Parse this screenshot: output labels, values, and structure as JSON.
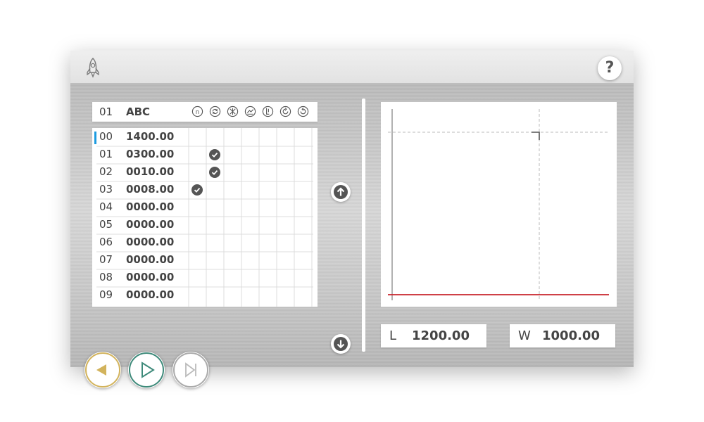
{
  "header": {
    "logo_icon": "rocket-icon",
    "help_label": "?"
  },
  "program": {
    "number": "01",
    "name": "ABC",
    "mode_icons": [
      "n-icon",
      "rotate-icon",
      "cross-icon",
      "bend-icon",
      "clamp-icon",
      "clockwise-icon",
      "counterclockwise-icon"
    ]
  },
  "steps": [
    {
      "id": "00",
      "value": "1400.00",
      "checked_col": null,
      "selected": true
    },
    {
      "id": "01",
      "value": "0300.00",
      "checked_col": 1,
      "selected": false
    },
    {
      "id": "02",
      "value": "0010.00",
      "checked_col": 1,
      "selected": false
    },
    {
      "id": "03",
      "value": "0008.00",
      "checked_col": 0,
      "selected": false
    },
    {
      "id": "04",
      "value": "0000.00",
      "checked_col": null,
      "selected": false
    },
    {
      "id": "05",
      "value": "0000.00",
      "checked_col": null,
      "selected": false
    },
    {
      "id": "06",
      "value": "0000.00",
      "checked_col": null,
      "selected": false
    },
    {
      "id": "07",
      "value": "0000.00",
      "checked_col": null,
      "selected": false
    },
    {
      "id": "08",
      "value": "0000.00",
      "checked_col": null,
      "selected": false
    },
    {
      "id": "09",
      "value": "0000.00",
      "checked_col": null,
      "selected": false
    }
  ],
  "dimensions": {
    "length_label": "L",
    "length_value": "1200.00",
    "width_label": "W",
    "width_value": "1000.00"
  },
  "colors": {
    "selection": "#1c9be0",
    "back_button": "#d2b35c",
    "play_button": "#3e8a7a",
    "baseline": "#c8242d"
  }
}
